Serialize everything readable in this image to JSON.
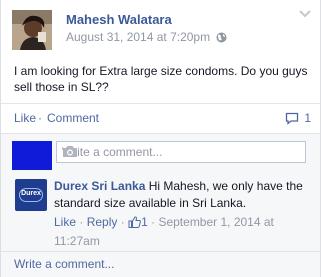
{
  "post": {
    "author": "Mahesh Walatara",
    "date": "August 31, 2014 at 7:20pm",
    "text": "I am looking for Extra large size condoms. Do you guys sell those in SL??",
    "privacy_icon": "globe-icon"
  },
  "actions": {
    "like_label": "Like",
    "separator": "·",
    "comment_label": "Comment",
    "comment_count": "1"
  },
  "composer": {
    "placeholder": "Write a comment..."
  },
  "reply": {
    "author": "Durex Sri Lanka",
    "text": "Hi Mahesh, we only have the standard size available in Sri Lanka.",
    "like_label": "Like",
    "reply_label": "Reply",
    "likes": "1",
    "date": "September 1, 2014 at 11:27am",
    "avatar_logo": "Durex"
  },
  "footer": {
    "write_comment": "Write a comment..."
  },
  "colors": {
    "link": "#3b5998",
    "link_light": "#4e69a2",
    "meta": "#9197a3",
    "viewer_avatar": "#0f1bd8"
  }
}
